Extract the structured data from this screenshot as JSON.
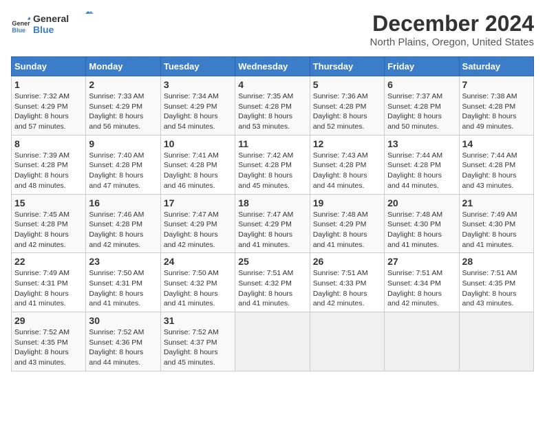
{
  "header": {
    "logo_line1": "General",
    "logo_line2": "Blue",
    "title": "December 2024",
    "subtitle": "North Plains, Oregon, United States"
  },
  "days_of_week": [
    "Sunday",
    "Monday",
    "Tuesday",
    "Wednesday",
    "Thursday",
    "Friday",
    "Saturday"
  ],
  "weeks": [
    [
      {
        "day": 1,
        "info": "Sunrise: 7:32 AM\nSunset: 4:29 PM\nDaylight: 8 hours\nand 57 minutes."
      },
      {
        "day": 2,
        "info": "Sunrise: 7:33 AM\nSunset: 4:29 PM\nDaylight: 8 hours\nand 56 minutes."
      },
      {
        "day": 3,
        "info": "Sunrise: 7:34 AM\nSunset: 4:29 PM\nDaylight: 8 hours\nand 54 minutes."
      },
      {
        "day": 4,
        "info": "Sunrise: 7:35 AM\nSunset: 4:28 PM\nDaylight: 8 hours\nand 53 minutes."
      },
      {
        "day": 5,
        "info": "Sunrise: 7:36 AM\nSunset: 4:28 PM\nDaylight: 8 hours\nand 52 minutes."
      },
      {
        "day": 6,
        "info": "Sunrise: 7:37 AM\nSunset: 4:28 PM\nDaylight: 8 hours\nand 50 minutes."
      },
      {
        "day": 7,
        "info": "Sunrise: 7:38 AM\nSunset: 4:28 PM\nDaylight: 8 hours\nand 49 minutes."
      }
    ],
    [
      {
        "day": 8,
        "info": "Sunrise: 7:39 AM\nSunset: 4:28 PM\nDaylight: 8 hours\nand 48 minutes."
      },
      {
        "day": 9,
        "info": "Sunrise: 7:40 AM\nSunset: 4:28 PM\nDaylight: 8 hours\nand 47 minutes."
      },
      {
        "day": 10,
        "info": "Sunrise: 7:41 AM\nSunset: 4:28 PM\nDaylight: 8 hours\nand 46 minutes."
      },
      {
        "day": 11,
        "info": "Sunrise: 7:42 AM\nSunset: 4:28 PM\nDaylight: 8 hours\nand 45 minutes."
      },
      {
        "day": 12,
        "info": "Sunrise: 7:43 AM\nSunset: 4:28 PM\nDaylight: 8 hours\nand 44 minutes."
      },
      {
        "day": 13,
        "info": "Sunrise: 7:44 AM\nSunset: 4:28 PM\nDaylight: 8 hours\nand 44 minutes."
      },
      {
        "day": 14,
        "info": "Sunrise: 7:44 AM\nSunset: 4:28 PM\nDaylight: 8 hours\nand 43 minutes."
      }
    ],
    [
      {
        "day": 15,
        "info": "Sunrise: 7:45 AM\nSunset: 4:28 PM\nDaylight: 8 hours\nand 42 minutes."
      },
      {
        "day": 16,
        "info": "Sunrise: 7:46 AM\nSunset: 4:28 PM\nDaylight: 8 hours\nand 42 minutes."
      },
      {
        "day": 17,
        "info": "Sunrise: 7:47 AM\nSunset: 4:29 PM\nDaylight: 8 hours\nand 42 minutes."
      },
      {
        "day": 18,
        "info": "Sunrise: 7:47 AM\nSunset: 4:29 PM\nDaylight: 8 hours\nand 41 minutes."
      },
      {
        "day": 19,
        "info": "Sunrise: 7:48 AM\nSunset: 4:29 PM\nDaylight: 8 hours\nand 41 minutes."
      },
      {
        "day": 20,
        "info": "Sunrise: 7:48 AM\nSunset: 4:30 PM\nDaylight: 8 hours\nand 41 minutes."
      },
      {
        "day": 21,
        "info": "Sunrise: 7:49 AM\nSunset: 4:30 PM\nDaylight: 8 hours\nand 41 minutes."
      }
    ],
    [
      {
        "day": 22,
        "info": "Sunrise: 7:49 AM\nSunset: 4:31 PM\nDaylight: 8 hours\nand 41 minutes."
      },
      {
        "day": 23,
        "info": "Sunrise: 7:50 AM\nSunset: 4:31 PM\nDaylight: 8 hours\nand 41 minutes."
      },
      {
        "day": 24,
        "info": "Sunrise: 7:50 AM\nSunset: 4:32 PM\nDaylight: 8 hours\nand 41 minutes."
      },
      {
        "day": 25,
        "info": "Sunrise: 7:51 AM\nSunset: 4:32 PM\nDaylight: 8 hours\nand 41 minutes."
      },
      {
        "day": 26,
        "info": "Sunrise: 7:51 AM\nSunset: 4:33 PM\nDaylight: 8 hours\nand 42 minutes."
      },
      {
        "day": 27,
        "info": "Sunrise: 7:51 AM\nSunset: 4:34 PM\nDaylight: 8 hours\nand 42 minutes."
      },
      {
        "day": 28,
        "info": "Sunrise: 7:51 AM\nSunset: 4:35 PM\nDaylight: 8 hours\nand 43 minutes."
      }
    ],
    [
      {
        "day": 29,
        "info": "Sunrise: 7:52 AM\nSunset: 4:35 PM\nDaylight: 8 hours\nand 43 minutes."
      },
      {
        "day": 30,
        "info": "Sunrise: 7:52 AM\nSunset: 4:36 PM\nDaylight: 8 hours\nand 44 minutes."
      },
      {
        "day": 31,
        "info": "Sunrise: 7:52 AM\nSunset: 4:37 PM\nDaylight: 8 hours\nand 45 minutes."
      },
      null,
      null,
      null,
      null
    ]
  ]
}
